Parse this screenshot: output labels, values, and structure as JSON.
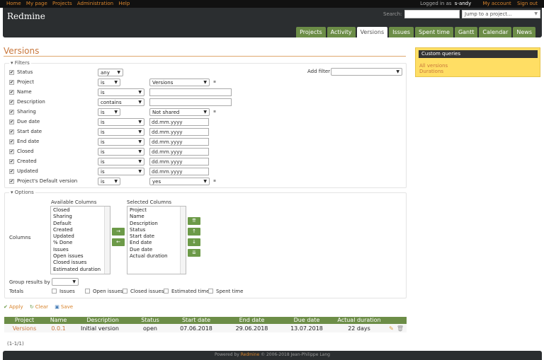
{
  "topnav": {
    "items": [
      "Home",
      "My page",
      "Projects",
      "Administration",
      "Help"
    ],
    "logged_in_as": "Logged in as",
    "username": "s-andy",
    "my_account": "My account",
    "sign_out": "Sign out"
  },
  "header": {
    "title": "Redmine",
    "search_label": "Search:",
    "search_value": "",
    "jump_to": "Jump to a project..."
  },
  "tabs": [
    {
      "label": "Projects"
    },
    {
      "label": "Activity"
    },
    {
      "label": "Versions",
      "active": true
    },
    {
      "label": "Issues"
    },
    {
      "label": "Spent time"
    },
    {
      "label": "Gantt"
    },
    {
      "label": "Calendar"
    },
    {
      "label": "News"
    }
  ],
  "page": {
    "title": "Versions"
  },
  "filters": {
    "legend": "Filters",
    "add_filter_label": "Add filter",
    "add_filter_value": "",
    "rows": [
      {
        "label": "Status",
        "operator": "any",
        "value": "",
        "kind": "none",
        "opw": 36
      },
      {
        "label": "Project",
        "operator": "is",
        "value": "Versions",
        "kind": "select",
        "opw": 32
      },
      {
        "label": "Name",
        "operator": "is",
        "value": "",
        "kind": "text",
        "opw": 66
      },
      {
        "label": "Description",
        "operator": "contains",
        "value": "",
        "kind": "text",
        "opw": 66
      },
      {
        "label": "Sharing",
        "operator": "is",
        "value": "Not shared",
        "kind": "select",
        "opw": 32
      },
      {
        "label": "Due date",
        "operator": "is",
        "value": "dd.mm.yyyy",
        "kind": "date",
        "opw": 66
      },
      {
        "label": "Start date",
        "operator": "is",
        "value": "dd.mm.yyyy",
        "kind": "date",
        "opw": 66
      },
      {
        "label": "End date",
        "operator": "is",
        "value": "dd.mm.yyyy",
        "kind": "date",
        "opw": 66
      },
      {
        "label": "Closed",
        "operator": "is",
        "value": "dd.mm.yyyy",
        "kind": "date",
        "opw": 66
      },
      {
        "label": "Created",
        "operator": "is",
        "value": "dd.mm.yyyy",
        "kind": "date",
        "opw": 66
      },
      {
        "label": "Updated",
        "operator": "is",
        "value": "dd.mm.yyyy",
        "kind": "date",
        "opw": 66
      },
      {
        "label": "Project's Default version",
        "operator": "is",
        "value": "yes",
        "kind": "select",
        "opw": 32
      }
    ]
  },
  "options": {
    "legend": "Options",
    "columns_label": "Columns",
    "available_label": "Available Columns",
    "available": [
      "Closed",
      "Sharing",
      "Default",
      "Created",
      "Updated",
      "% Done",
      "Issues",
      "Open issues",
      "Closed issues",
      "Estimated duration"
    ],
    "selected_label": "Selected Columns",
    "selected": [
      "Project",
      "Name",
      "Description",
      "Status",
      "Start date",
      "End date",
      "Due date",
      "Actual duration"
    ],
    "group_label": "Group results by",
    "group_value": "",
    "totals_label": "Totals",
    "totals": [
      "Issues",
      "Open issues",
      "Closed issues",
      "Estimated time",
      "Spent time"
    ]
  },
  "actions": {
    "apply": "Apply",
    "clear": "Clear",
    "save": "Save"
  },
  "table": {
    "columns": [
      "Project",
      "Name",
      "Description",
      "Status",
      "Start date",
      "End date",
      "Due date",
      "Actual duration"
    ],
    "rows": [
      {
        "project": "Versions",
        "name": "0.0.1",
        "description": "Initial version",
        "status": "open",
        "start_date": "07.06.2018",
        "end_date": "29.06.2018",
        "due_date": "13.07.2018",
        "actual_duration": "22 days"
      }
    ]
  },
  "pagination": "(1-1/1)",
  "footer": {
    "prefix": "Powered by",
    "brand": "Redmine",
    "suffix": "© 2006-2018 Jean-Philippe Lang"
  },
  "sidebar": {
    "title": "Custom queries",
    "links": [
      "All versions",
      "Durations"
    ]
  }
}
